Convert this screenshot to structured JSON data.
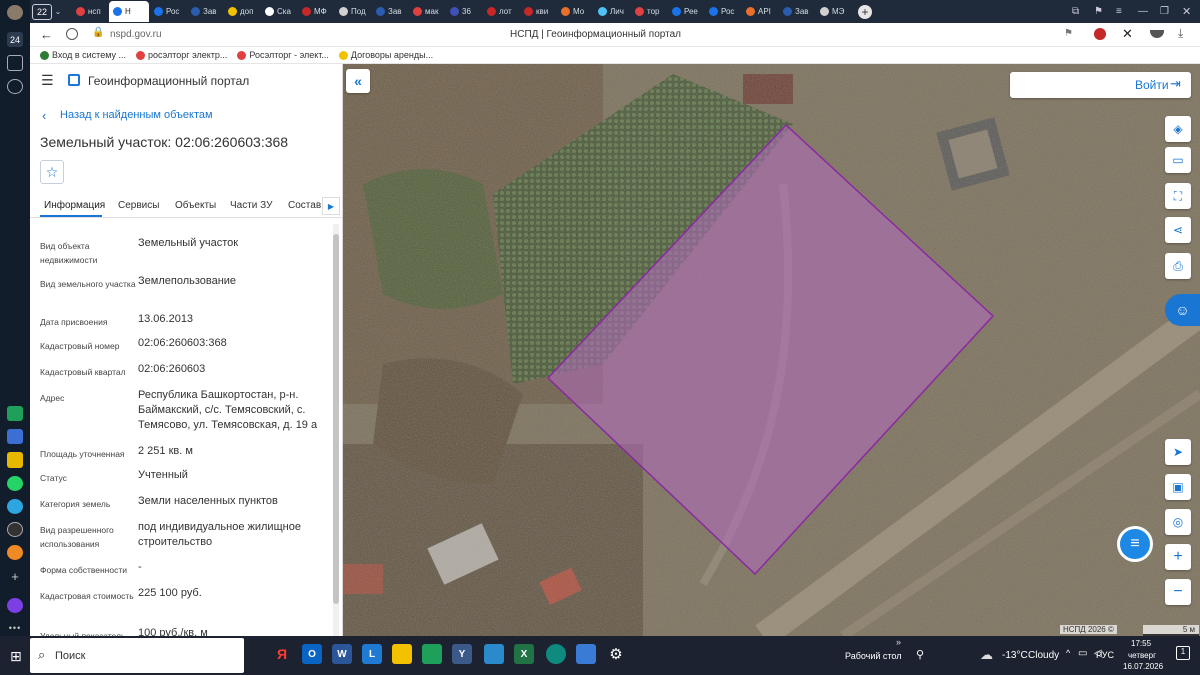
{
  "browser": {
    "tab_count": "22",
    "tabs": [
      {
        "label": "нсп",
        "color": "#e04040"
      },
      {
        "label": "Н",
        "color": "#1a73e8",
        "active": true
      },
      {
        "label": "Рос",
        "color": "#1a73e8"
      },
      {
        "label": "Зав",
        "color": "#2a5db0"
      },
      {
        "label": "доп",
        "color": "#f2c200"
      },
      {
        "label": "Ска",
        "color": "#ffffff"
      },
      {
        "label": "МФ",
        "color": "#c62828"
      },
      {
        "label": "Под",
        "color": "#d0d0d0"
      },
      {
        "label": "Зав",
        "color": "#2a5db0"
      },
      {
        "label": "мак",
        "color": "#e04040"
      },
      {
        "label": "36 ",
        "color": "#3f51b5"
      },
      {
        "label": "лот",
        "color": "#c62828"
      },
      {
        "label": "кви",
        "color": "#c62828"
      },
      {
        "label": "Мо",
        "color": "#e8702a"
      },
      {
        "label": "Лич",
        "color": "#4fc3f7"
      },
      {
        "label": "тор",
        "color": "#e04040"
      },
      {
        "label": "Рее",
        "color": "#1a73e8"
      },
      {
        "label": "Рос",
        "color": "#1a73e8"
      },
      {
        "label": "API",
        "color": "#e8702a"
      },
      {
        "label": "Зав",
        "color": "#2a5db0"
      },
      {
        "label": "МЭ",
        "color": "#d0d0d0"
      }
    ],
    "url": "nspd.gov.ru",
    "page_title": "НСПД | Геоинформационный портал",
    "bookmarks": [
      {
        "label": "Вход в систему ...",
        "color": "#2e7d32"
      },
      {
        "label": "росэлторг электр...",
        "color": "#e04040"
      },
      {
        "label": "Росэлторг - элект...",
        "color": "#e04040"
      },
      {
        "label": "Договоры аренды...",
        "color": "#f2c200"
      }
    ]
  },
  "portal": {
    "title": "Геоинформационный портал",
    "back_link": "Назад к найденным объектам",
    "object_title": "Земельный участок: 02:06:260603:368",
    "tabs": [
      "Информация",
      "Сервисы",
      "Объекты",
      "Части ЗУ",
      "Состав"
    ],
    "fields": [
      {
        "label": "Вид объекта недвижимости",
        "value": "Земельный участок"
      },
      {
        "label": "Вид земельного участка",
        "value": "Землепользование"
      },
      {
        "label": "Дата присвоения",
        "value": "13.06.2013"
      },
      {
        "label": "Кадастровый номер",
        "value": "02:06:260603:368"
      },
      {
        "label": "Кадастровый квартал",
        "value": "02:06:260603"
      },
      {
        "label": "Адрес",
        "value": "Республика Башкортостан, р-н. Баймакский, с/с. Темясовский, с. Темясово, ул. Темясовская, д. 19 а"
      },
      {
        "label": "Площадь уточненная",
        "value": "2 251 кв. м"
      },
      {
        "label": "Статус",
        "value": "Учтенный"
      },
      {
        "label": "Категория земель",
        "value": "Земли населенных пунктов"
      },
      {
        "label": "Вид разрешенного использования",
        "value": "под индивидуальное жилищное строительство"
      },
      {
        "label": "Форма собственности",
        "value": "-"
      },
      {
        "label": "Кадастровая стоимость",
        "value": "225 100 руб."
      },
      {
        "label": "Удельный показатель",
        "value": "100 руб./кв. м"
      }
    ],
    "login": "Войти",
    "copyright": "НСПД 2026 ©",
    "scale": "5 м"
  },
  "taskbar": {
    "search": "Поиск",
    "desktop": "Рабочий стол",
    "weather_temp": "-13°C",
    "weather_text": "Cloudy",
    "lang": "РУС",
    "time": "17:55",
    "day": "четверг",
    "date": "16.07.2026"
  }
}
